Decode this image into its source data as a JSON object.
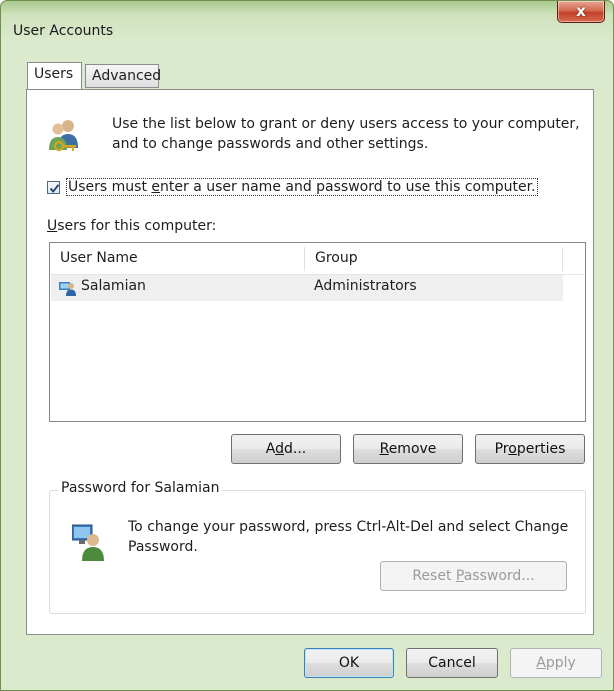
{
  "window": {
    "title": "User Accounts",
    "close_glyph": "x"
  },
  "tabs": [
    {
      "label": "Users",
      "active": true
    },
    {
      "label": "Advanced",
      "active": false
    }
  ],
  "intro": {
    "text": "Use the list below to grant or deny users access to your computer, and to change passwords and other settings.",
    "icon": "users-keys-icon"
  },
  "login_checkbox": {
    "checked": true,
    "label_pre": "Users must ",
    "label_accel": "e",
    "label_post": "nter a user name and password to use this computer."
  },
  "users_section": {
    "label_accel": "U",
    "label_post": "sers for this computer:"
  },
  "list": {
    "columns": [
      "User Name",
      "Group"
    ],
    "rows": [
      {
        "name": "Salamian",
        "group": "Administrators",
        "icon": "admin-user-icon"
      }
    ]
  },
  "buttons": {
    "add": {
      "pre": "A",
      "accel": "d",
      "post": "d..."
    },
    "remove": {
      "pre": "",
      "accel": "R",
      "post": "emove"
    },
    "properties": {
      "pre": "Pr",
      "accel": "o",
      "post": "perties"
    },
    "reset": {
      "pre": "Reset ",
      "accel": "P",
      "post": "assword..."
    },
    "ok": "OK",
    "cancel": "Cancel",
    "apply": {
      "pre": "",
      "accel": "A",
      "post": "pply"
    }
  },
  "password_group": {
    "title": "Password for Salamian",
    "text": "To change your password, press Ctrl-Alt-Del and select Change Password.",
    "icon": "user-monitor-icon"
  },
  "colors": {
    "frame": "#dbe9cd",
    "close": "#c1412a",
    "accent": "#3c7fb1"
  }
}
